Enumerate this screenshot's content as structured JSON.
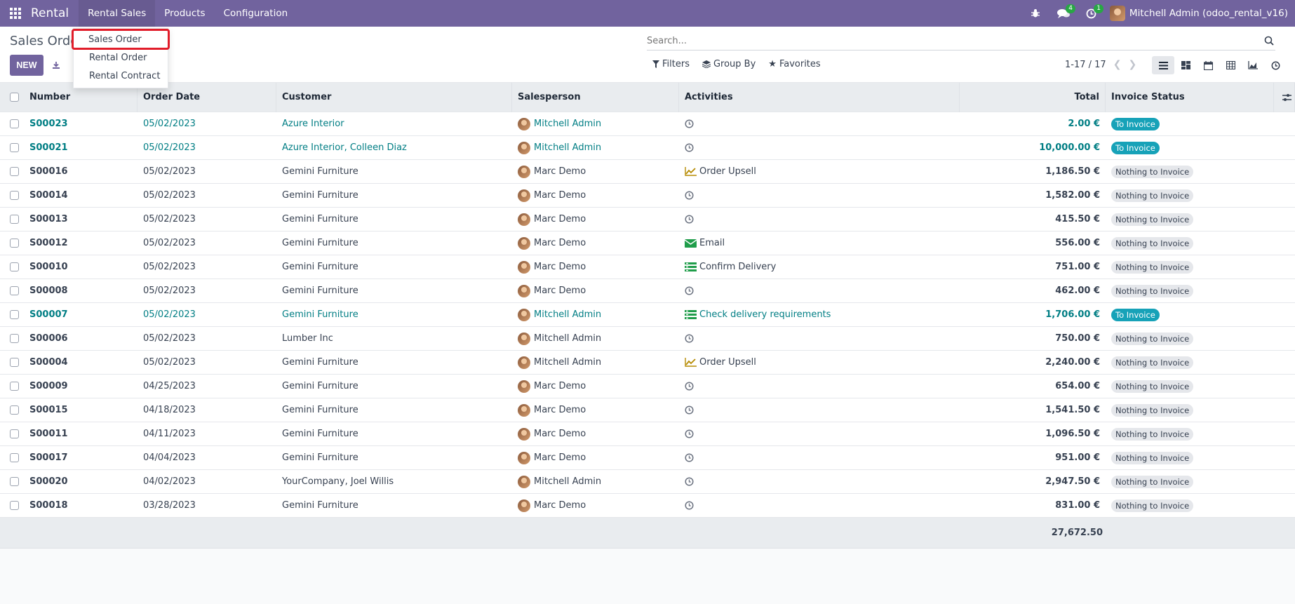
{
  "navbar": {
    "brand": "Rental",
    "menus": [
      "Rental Sales",
      "Products",
      "Configuration"
    ],
    "messages_count": "4",
    "activities_count": "1",
    "user": "Mitchell Admin (odoo_rental_v16)"
  },
  "dropdown": {
    "items": [
      "Sales Order",
      "Rental Order",
      "Rental Contract"
    ]
  },
  "control": {
    "title": "Sales Orde",
    "new_label": "NEW",
    "search_placeholder": "Search...",
    "filters": "Filters",
    "group_by": "Group By",
    "favorites": "Favorites",
    "pager": "1-17 / 17"
  },
  "table": {
    "headers": [
      "Number",
      "Order Date",
      "Customer",
      "Salesperson",
      "Activities",
      "Total",
      "Invoice Status"
    ],
    "rows": [
      {
        "number": "S00023",
        "date": "05/02/2023",
        "customer": "Azure Interior",
        "salesperson": "Mitchell Admin",
        "activity": "",
        "activity_icon": "clock",
        "total": "2.00 €",
        "status": "To Invoice"
      },
      {
        "number": "S00021",
        "date": "05/02/2023",
        "customer": "Azure Interior, Colleen Diaz",
        "salesperson": "Mitchell Admin",
        "activity": "",
        "activity_icon": "clock",
        "total": "10,000.00 €",
        "status": "To Invoice"
      },
      {
        "number": "S00016",
        "date": "05/02/2023",
        "customer": "Gemini Furniture",
        "salesperson": "Marc Demo",
        "activity": "Order Upsell",
        "activity_icon": "upsell",
        "total": "1,186.50 €",
        "status": "Nothing to Invoice"
      },
      {
        "number": "S00014",
        "date": "05/02/2023",
        "customer": "Gemini Furniture",
        "salesperson": "Marc Demo",
        "activity": "",
        "activity_icon": "clock",
        "total": "1,582.00 €",
        "status": "Nothing to Invoice"
      },
      {
        "number": "S00013",
        "date": "05/02/2023",
        "customer": "Gemini Furniture",
        "salesperson": "Marc Demo",
        "activity": "",
        "activity_icon": "clock",
        "total": "415.50 €",
        "status": "Nothing to Invoice"
      },
      {
        "number": "S00012",
        "date": "05/02/2023",
        "customer": "Gemini Furniture",
        "salesperson": "Marc Demo",
        "activity": "Email",
        "activity_icon": "email",
        "total": "556.00 €",
        "status": "Nothing to Invoice"
      },
      {
        "number": "S00010",
        "date": "05/02/2023",
        "customer": "Gemini Furniture",
        "salesperson": "Marc Demo",
        "activity": "Confirm Delivery",
        "activity_icon": "task",
        "total": "751.00 €",
        "status": "Nothing to Invoice"
      },
      {
        "number": "S00008",
        "date": "05/02/2023",
        "customer": "Gemini Furniture",
        "salesperson": "Marc Demo",
        "activity": "",
        "activity_icon": "clock",
        "total": "462.00 €",
        "status": "Nothing to Invoice"
      },
      {
        "number": "S00007",
        "date": "05/02/2023",
        "customer": "Gemini Furniture",
        "salesperson": "Mitchell Admin",
        "activity": "Check delivery requirements",
        "activity_icon": "task",
        "total": "1,706.00 €",
        "status": "To Invoice"
      },
      {
        "number": "S00006",
        "date": "05/02/2023",
        "customer": "Lumber Inc",
        "salesperson": "Mitchell Admin",
        "activity": "",
        "activity_icon": "clock",
        "total": "750.00 €",
        "status": "Nothing to Invoice"
      },
      {
        "number": "S00004",
        "date": "05/02/2023",
        "customer": "Gemini Furniture",
        "salesperson": "Mitchell Admin",
        "activity": "Order Upsell",
        "activity_icon": "upsell",
        "total": "2,240.00 €",
        "status": "Nothing to Invoice"
      },
      {
        "number": "S00009",
        "date": "04/25/2023",
        "customer": "Gemini Furniture",
        "salesperson": "Marc Demo",
        "activity": "",
        "activity_icon": "clock",
        "total": "654.00 €",
        "status": "Nothing to Invoice"
      },
      {
        "number": "S00015",
        "date": "04/18/2023",
        "customer": "Gemini Furniture",
        "salesperson": "Marc Demo",
        "activity": "",
        "activity_icon": "clock",
        "total": "1,541.50 €",
        "status": "Nothing to Invoice"
      },
      {
        "number": "S00011",
        "date": "04/11/2023",
        "customer": "Gemini Furniture",
        "salesperson": "Marc Demo",
        "activity": "",
        "activity_icon": "clock",
        "total": "1,096.50 €",
        "status": "Nothing to Invoice"
      },
      {
        "number": "S00017",
        "date": "04/04/2023",
        "customer": "Gemini Furniture",
        "salesperson": "Marc Demo",
        "activity": "",
        "activity_icon": "clock",
        "total": "951.00 €",
        "status": "Nothing to Invoice"
      },
      {
        "number": "S00020",
        "date": "04/02/2023",
        "customer": "YourCompany, Joel Willis",
        "salesperson": "Mitchell Admin",
        "activity": "",
        "activity_icon": "clock",
        "total": "2,947.50 €",
        "status": "Nothing to Invoice"
      },
      {
        "number": "S00018",
        "date": "03/28/2023",
        "customer": "Gemini Furniture",
        "salesperson": "Marc Demo",
        "activity": "",
        "activity_icon": "clock",
        "total": "831.00 €",
        "status": "Nothing to Invoice"
      }
    ],
    "grand_total": "27,672.50"
  },
  "colors": {
    "brand": "#71639e",
    "link": "#017e84",
    "to_invoice_badge": "#17a2b8",
    "highlight": "#e11d2a"
  }
}
